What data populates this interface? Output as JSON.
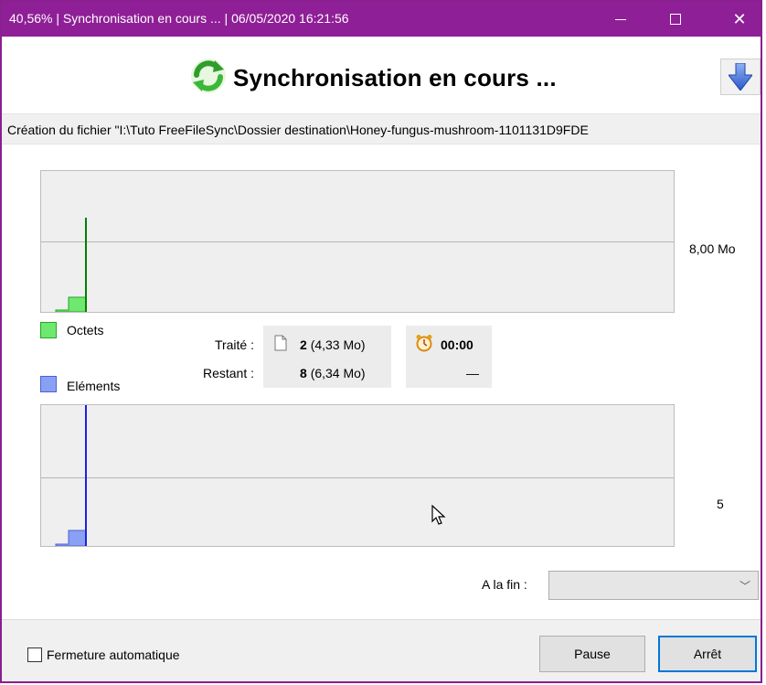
{
  "window": {
    "title": "40,56% | Synchronisation en cours ... | 06/05/2020 16:21:56",
    "progress_percent": 40.56,
    "accent_color": "#8f1f96"
  },
  "header": {
    "heading": "Synchronisation en cours ...",
    "status_icon": "sync-arrows-icon",
    "collapse_icon": "arrow-down-icon"
  },
  "status_line": "Création du fichier \"I:\\Tuto FreeFileSync\\Dossier destination\\Honey-fungus-mushroom-1101131D9FDE",
  "graphs": {
    "bytes": {
      "legend": "Octets",
      "scale_label": "8,00 Mo",
      "color": "#6ee86e",
      "line_color": "#008000"
    },
    "items": {
      "legend": "Eléments",
      "scale_label": "5",
      "color": "#8aa0f5",
      "line_color": "#2020e0"
    }
  },
  "stats": {
    "processed_label": "Traité :",
    "remaining_label": "Restant :",
    "processed_count": "2",
    "processed_size": "(4,33 Mo)",
    "remaining_count": "8",
    "remaining_size": "(6,34 Mo)",
    "elapsed_time": "00:00",
    "remaining_time": "—",
    "file_icon": "file-icon",
    "clock_icon": "alarm-clock-icon"
  },
  "on_completion": {
    "label": "A la fin :",
    "value": ""
  },
  "footer": {
    "auto_close_label": "Fermeture automatique",
    "auto_close_checked": false,
    "pause_label": "Pause",
    "stop_label": "Arrêt"
  }
}
